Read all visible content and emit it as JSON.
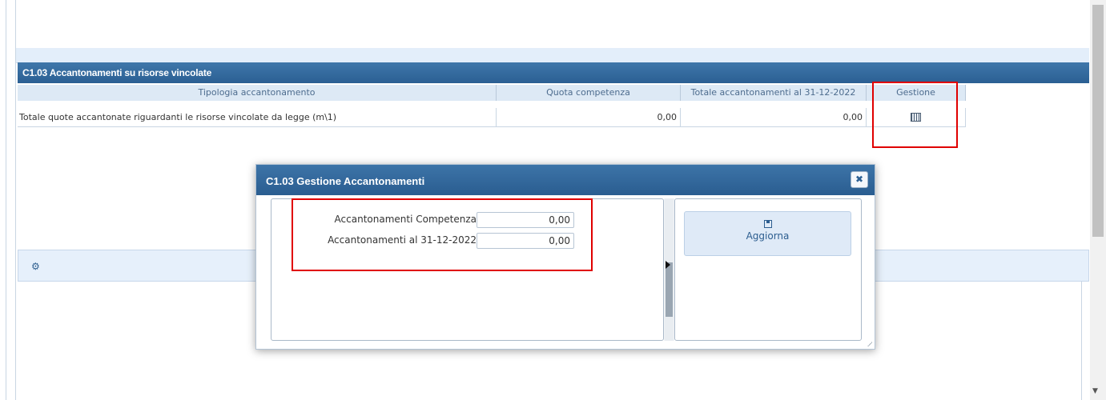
{
  "section": {
    "title": "C1.03 Accantonamenti su risorse vincolate",
    "columns": [
      "Tipologia accantonamento",
      "Quota competenza",
      "Totale accantonamenti al 31-12-2022",
      "Gestione"
    ],
    "rows": [
      {
        "tipologia": "Totale quote accantonate riguardanti le risorse vincolate da legge (m\\1)",
        "quota_competenza": "0,00",
        "totale": "0,00",
        "gestione_icon": "grid-icon"
      }
    ]
  },
  "settings_panel": {
    "icon": "gear-icon"
  },
  "dialog": {
    "title": "C1.03 Gestione Accantonamenti",
    "close_icon": "close-icon",
    "fields": [
      {
        "label": "Accantonamenti Competenza",
        "value": "0,00"
      },
      {
        "label": "Accantonamenti al 31-12-2022",
        "value": "0,00"
      }
    ],
    "update_button": {
      "icon": "save-icon",
      "label": "Aggiorna"
    }
  },
  "colors": {
    "header_blue": "#2b5f93",
    "highlight_red": "#e00000",
    "light_blue_panel": "#e6f0fb"
  }
}
